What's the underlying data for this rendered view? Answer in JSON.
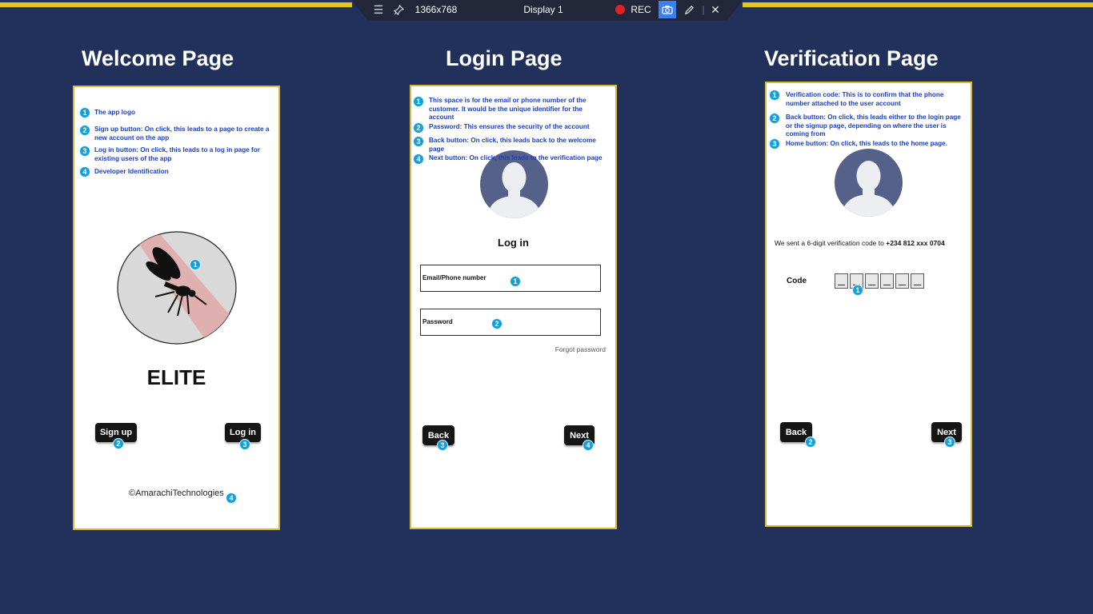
{
  "toolbar": {
    "resolution": "1366x768",
    "display": "Display 1",
    "rec": "REC",
    "icons": [
      "menu-icon",
      "pin-icon",
      "camera-icon",
      "pencil-icon",
      "close-icon"
    ]
  },
  "welcome": {
    "heading": "Welcome Page",
    "notes": [
      {
        "num": "1",
        "text": "The app logo"
      },
      {
        "num": "2",
        "text": "Sign up button: On click, this leads to a page to create a new account on the app"
      },
      {
        "num": "3",
        "text": "Log in button: On click, this leads to a log in page for existing users of the app"
      },
      {
        "num": "4",
        "text": "Developer Identification"
      }
    ],
    "logo_marker": "1",
    "app_name": "ELITE",
    "signup_label": "Sign up",
    "signup_marker": "2",
    "login_label": "Log in",
    "login_marker": "3",
    "credit": "©AmarachiTechnologies",
    "credit_marker": "4"
  },
  "login": {
    "heading": "Login Page",
    "notes": [
      {
        "num": "1",
        "text": "This space is for the email or phone number of the customer. It would be the unique identifier for the account"
      },
      {
        "num": "2",
        "text": "Password: This ensures the security of the account"
      },
      {
        "num": "3",
        "text": "Back button: On click, this leads back to the welcome page"
      },
      {
        "num": "4",
        "text": "Next button: On click, this leads to the verification page"
      }
    ],
    "title": "Log in",
    "email_label": "Email/Phone number",
    "email_marker": "1",
    "password_label": "Password",
    "password_marker": "2",
    "forgot": "Forgot password",
    "back_label": "Back",
    "back_marker": "3",
    "next_label": "Next",
    "next_marker": "4"
  },
  "verification": {
    "heading": "Verification Page",
    "notes": [
      {
        "num": "1",
        "text": "Verification code: This is to confirm that the phone number attached to the user account"
      },
      {
        "num": "2",
        "text": "Back button: On click, this leads either to the login page or the signup page, depending on where the user is coming from"
      },
      {
        "num": "3",
        "text": "Home button: On click, this leads to the home page."
      }
    ],
    "sent_text": "We sent a 6-digit verification code to ",
    "phone": "+234 812 xxx 0704",
    "code_label": "Code",
    "code_marker": "1",
    "back_label": "Back",
    "back_marker": "2",
    "next_label": "Next",
    "next_marker": "3"
  }
}
